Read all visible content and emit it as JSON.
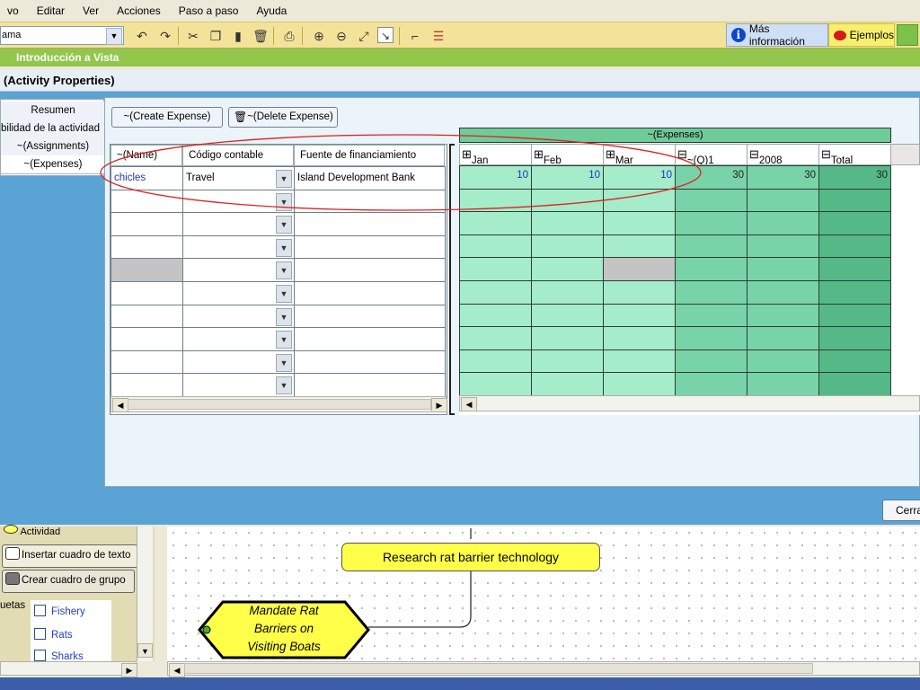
{
  "menu": [
    "vo",
    "Editar",
    "Ver",
    "Acciones",
    "Paso a paso",
    "Ayuda"
  ],
  "toolbar": {
    "combo_value": "ama",
    "more_info": "Más información",
    "examples": "Ejemplos"
  },
  "green_bar": "Introducción a Vista",
  "dialog": {
    "title": "(Activity Properties)",
    "left_tabs": [
      "Resumen",
      "bilidad de la actividad",
      "~(Assignments)",
      "~(Expenses)"
    ],
    "buttons": {
      "create": "~(Create Expense)",
      "delete": "~(Delete Expense)"
    },
    "close": "Cerra"
  },
  "expense_table": {
    "columns": [
      "~(Name)",
      "Código contable",
      "Fuente de financiamiento"
    ],
    "rows": [
      {
        "name": "chicles",
        "code": "Travel",
        "source": "Island Development Bank"
      },
      {
        "name": "",
        "code": "",
        "source": ""
      },
      {
        "name": "",
        "code": "",
        "source": ""
      },
      {
        "name": "",
        "code": "",
        "source": ""
      },
      {
        "name": "",
        "code": "",
        "source": ""
      },
      {
        "name": "",
        "code": "",
        "source": ""
      },
      {
        "name": "",
        "code": "",
        "source": ""
      },
      {
        "name": "",
        "code": "",
        "source": ""
      },
      {
        "name": "",
        "code": "",
        "source": ""
      },
      {
        "name": "",
        "code": "",
        "source": ""
      }
    ]
  },
  "expenses_grid": {
    "group_header": "~(Expenses)",
    "columns": [
      "Jan",
      "Feb",
      "Mar",
      "~(Q)1",
      "2008",
      "Total"
    ],
    "first_row": [
      "10",
      "10",
      "10",
      "30",
      "30",
      "30"
    ]
  },
  "left_pane": {
    "activity_label": "Actividad",
    "insert_text_box": "Insertar cuadro de texto",
    "create_group_box": "Crear cuadro de grupo",
    "labels_title": "uetas",
    "labels": [
      "Fishery",
      "Rats",
      "Sharks"
    ]
  },
  "canvas": {
    "node_research": "Research rat barrier technology",
    "node_mandate": [
      "Mandate Rat",
      "Barriers on",
      "Visiting Boats"
    ]
  },
  "colors": {
    "toolbar": "#f3e39a",
    "green_bar": "#92c64c",
    "dialog_blue": "#5aa3d4",
    "grid_month": "#a5eccb",
    "grid_quarter": "#78d3a8",
    "grid_total": "#55b987",
    "node_yellow": "#ffff4a"
  }
}
